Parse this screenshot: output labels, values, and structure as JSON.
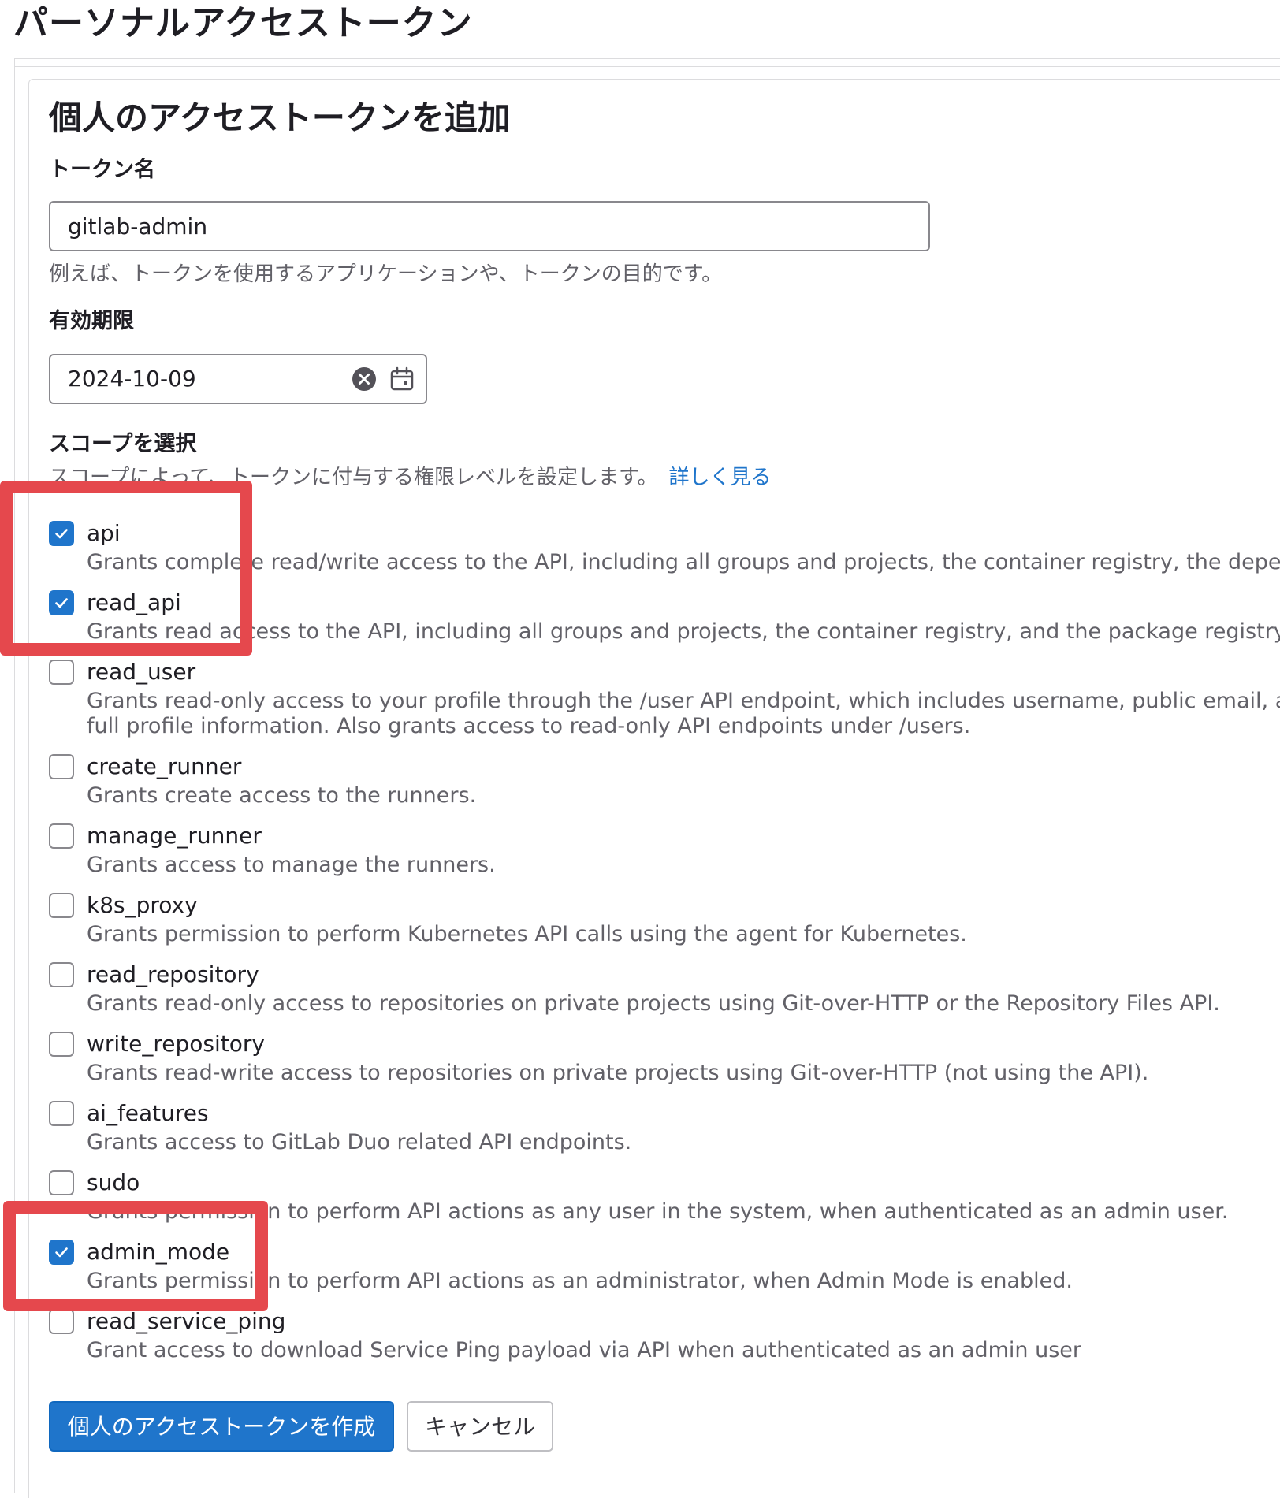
{
  "page": {
    "title": "パーソナルアクセストークン"
  },
  "form": {
    "title": "個人のアクセストークンを追加",
    "token_name": {
      "label": "トークン名",
      "value": "gitlab-admin",
      "help": "例えば、トークンを使用するアプリケーションや、トークンの目的です。"
    },
    "expiry": {
      "label": "有効期限",
      "value": "2024-10-09",
      "clear_icon": "clear-circle-icon",
      "calendar_icon": "calendar-icon"
    },
    "scopes": {
      "label": "スコープを選択",
      "help": "スコープによって、トークンに付与する権限レベルを設定します。",
      "help_link": "詳しく見る",
      "items": [
        {
          "name": "api",
          "checked": true,
          "description": "Grants complete read/write access to the API, including all groups and projects, the container registry, the depend"
        },
        {
          "name": "read_api",
          "checked": true,
          "description": "Grants read access to the API, including all groups and projects, the container registry, and the package registry."
        },
        {
          "name": "read_user",
          "checked": false,
          "description": "Grants read-only access to your profile through the /user API endpoint, which includes username, public email, and full profile information. Also grants access to read-only API endpoints under /users."
        },
        {
          "name": "create_runner",
          "checked": false,
          "description": "Grants create access to the runners."
        },
        {
          "name": "manage_runner",
          "checked": false,
          "description": "Grants access to manage the runners."
        },
        {
          "name": "k8s_proxy",
          "checked": false,
          "description": "Grants permission to perform Kubernetes API calls using the agent for Kubernetes."
        },
        {
          "name": "read_repository",
          "checked": false,
          "description": "Grants read-only access to repositories on private projects using Git-over-HTTP or the Repository Files API."
        },
        {
          "name": "write_repository",
          "checked": false,
          "description": "Grants read-write access to repositories on private projects using Git-over-HTTP (not using the API)."
        },
        {
          "name": "ai_features",
          "checked": false,
          "description": "Grants access to GitLab Duo related API endpoints."
        },
        {
          "name": "sudo",
          "checked": false,
          "description": "Grants permission to perform API actions as any user in the system, when authenticated as an admin user."
        },
        {
          "name": "admin_mode",
          "checked": true,
          "description": "Grants permission to perform API actions as an administrator, when Admin Mode is enabled."
        },
        {
          "name": "read_service_ping",
          "checked": false,
          "description": "Grant access to download Service Ping payload via API when authenticated as an admin user"
        }
      ]
    },
    "actions": {
      "create_label": "個人のアクセストークンを作成",
      "cancel_label": "キャンセル"
    }
  },
  "colors": {
    "primary": "#1f75cb",
    "highlight": "#e5484d",
    "muted_text": "#626168",
    "link": "#1f75cb"
  }
}
